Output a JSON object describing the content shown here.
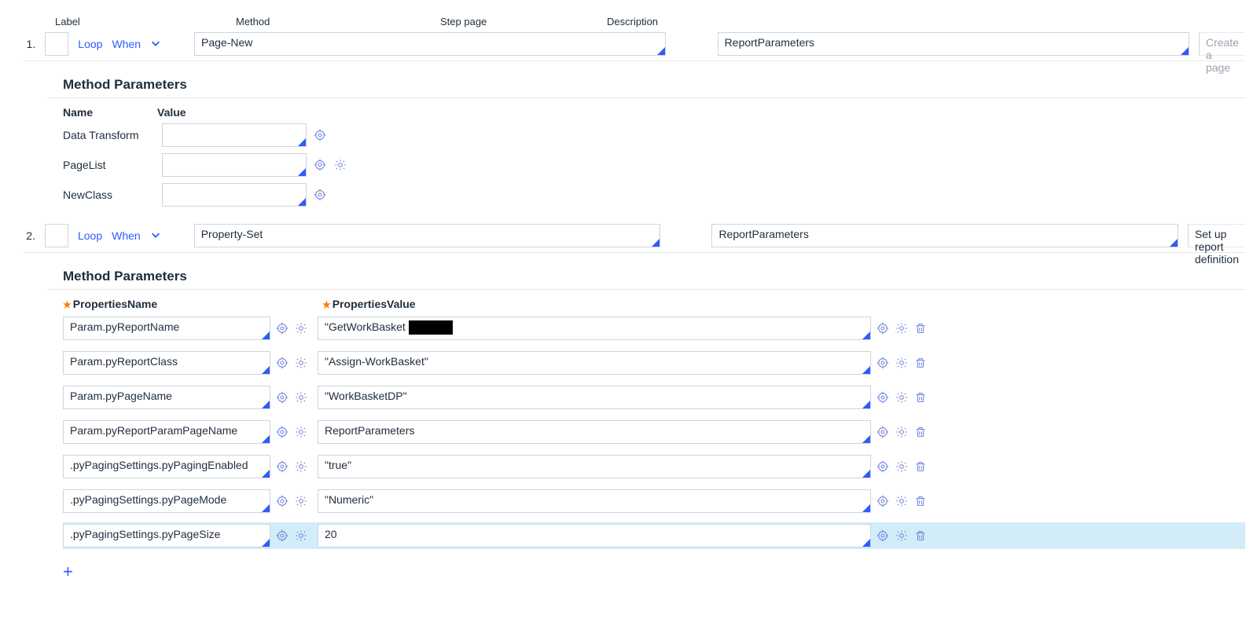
{
  "headers": {
    "label": "Label",
    "method": "Method",
    "stepPage": "Step page",
    "description": "Description"
  },
  "links": {
    "loop": "Loop",
    "when": "When"
  },
  "steps": [
    {
      "num": "1.",
      "label": "",
      "method": "Page-New",
      "stepPage": "ReportParameters",
      "description": "",
      "descriptionPlaceholder": "Create a page"
    },
    {
      "num": "2.",
      "label": "",
      "method": "Property-Set",
      "stepPage": "ReportParameters",
      "description": "Set up report definition",
      "descriptionPlaceholder": ""
    }
  ],
  "sectionTitle": "Method Parameters",
  "params1": {
    "colName": "Name",
    "colValue": "Value",
    "rows": [
      {
        "name": "Data Transform",
        "value": "",
        "gear": false
      },
      {
        "name": "PageList",
        "value": "",
        "gear": true
      },
      {
        "name": "NewClass",
        "value": "",
        "gear": false
      }
    ]
  },
  "params2": {
    "colPropsName": "PropertiesName",
    "colPropsValue": "PropertiesValue",
    "rows": [
      {
        "name": "Param.pyReportName",
        "value": "\"GetWorkBasket█████\""
      },
      {
        "name": "Param.pyReportClass",
        "value": "\"Assign-WorkBasket\""
      },
      {
        "name": "Param.pyPageName",
        "value": "\"WorkBasketDP\""
      },
      {
        "name": "Param.pyReportParamPageName",
        "value": "ReportParameters"
      },
      {
        "name": ".pyPagingSettings.pyPagingEnabled",
        "value": "\"true\""
      },
      {
        "name": ".pyPagingSettings.pyPageMode",
        "value": "\"Numeric\""
      },
      {
        "name": ".pyPagingSettings.pyPageSize",
        "value": "20",
        "selected": true
      }
    ]
  }
}
